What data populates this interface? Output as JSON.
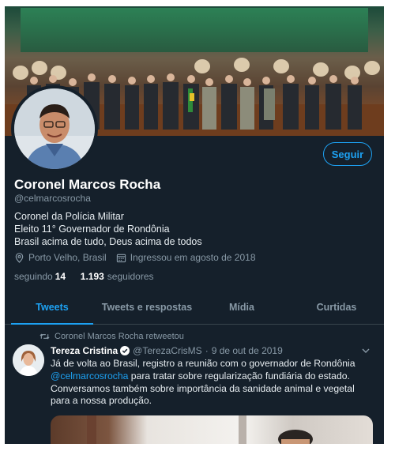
{
  "profile": {
    "name": "Coronel Marcos Rocha",
    "handle": "@celmarcosrocha",
    "bio": [
      "Coronel da Polícia Militar",
      "Eleito 11° Governador de Rondônia",
      "Brasil acima de tudo, Deus acima de todos"
    ],
    "location": "Porto Velho, Brasil",
    "joined": "Ingressou em agosto de 2018",
    "following_count": "14",
    "following_label": "seguindo",
    "followers_count": "1.193",
    "followers_label": "seguidores",
    "follow_button": "Seguir"
  },
  "tabs": [
    {
      "label": "Tweets",
      "active": true
    },
    {
      "label": "Tweets e respostas",
      "active": false
    },
    {
      "label": "Mídia",
      "active": false
    },
    {
      "label": "Curtidas",
      "active": false
    }
  ],
  "tweet": {
    "retweet_note": "Coronel Marcos Rocha retweetou",
    "author": "Tereza Cristina",
    "handle": "@TerezaCrisMS",
    "separator": "·",
    "date": "9 de out de 2019",
    "body_1": "Já de volta ao Brasil, registro a reunião com o governador de Rondônia",
    "mention": "@celmarcosrocha",
    "body_2": " para tratar sobre regularização fundiária do estado.",
    "body_3": "Conversamos também sobre importância da sanidade animal e vegetal para a nossa produção."
  },
  "colors": {
    "background": "#15202b",
    "accent": "#1da1f2",
    "muted_text": "#8899a6",
    "border": "#38444d"
  },
  "icons": [
    "location-icon",
    "calendar-icon",
    "retweet-icon",
    "verified-icon",
    "chevron-down-icon"
  ]
}
